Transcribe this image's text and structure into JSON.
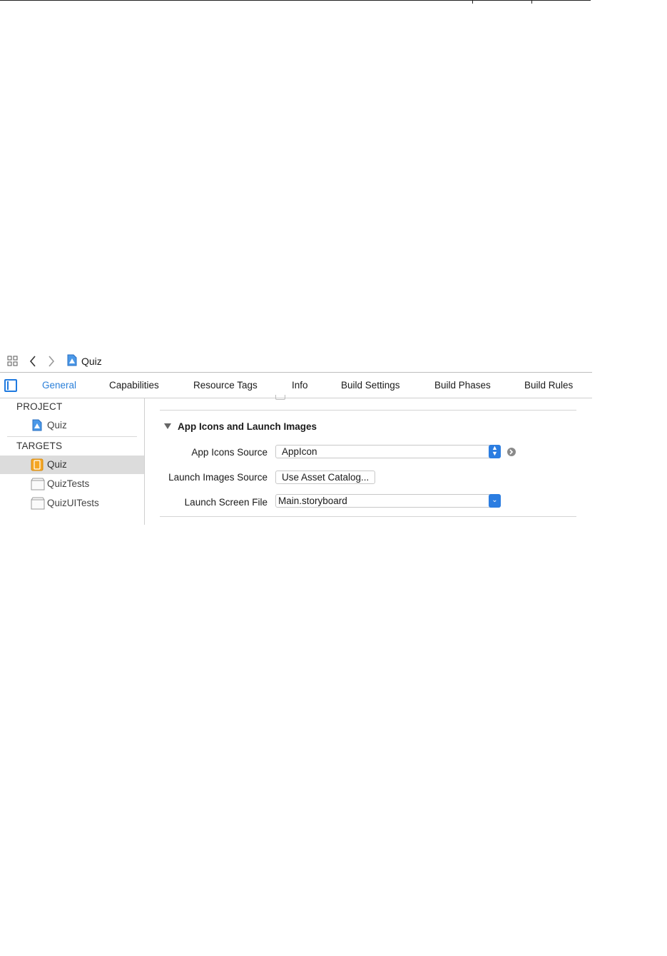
{
  "breadcrumb": {
    "project_name": "Quiz"
  },
  "tabs": [
    {
      "label": "General",
      "active": true
    },
    {
      "label": "Capabilities"
    },
    {
      "label": "Resource Tags"
    },
    {
      "label": "Info"
    },
    {
      "label": "Build Settings"
    },
    {
      "label": "Build Phases"
    },
    {
      "label": "Build Rules"
    }
  ],
  "sidebar": {
    "project_header": "PROJECT",
    "project_items": [
      {
        "label": "Quiz"
      }
    ],
    "targets_header": "TARGETS",
    "target_items": [
      {
        "label": "Quiz",
        "selected": true
      },
      {
        "label": "QuizTests"
      },
      {
        "label": "QuizUITests"
      }
    ]
  },
  "section": {
    "title": "App Icons and Launch Images",
    "app_icons_source_label": "App Icons Source",
    "app_icons_source_value": "AppIcon",
    "launch_images_source_label": "Launch Images Source",
    "launch_images_source_button": "Use Asset Catalog...",
    "launch_screen_file_label": "Launch Screen File",
    "launch_screen_file_value": "Main.storyboard"
  },
  "colors": {
    "accent": "#2a7fd9",
    "selected_row": "#dcdcdc"
  }
}
